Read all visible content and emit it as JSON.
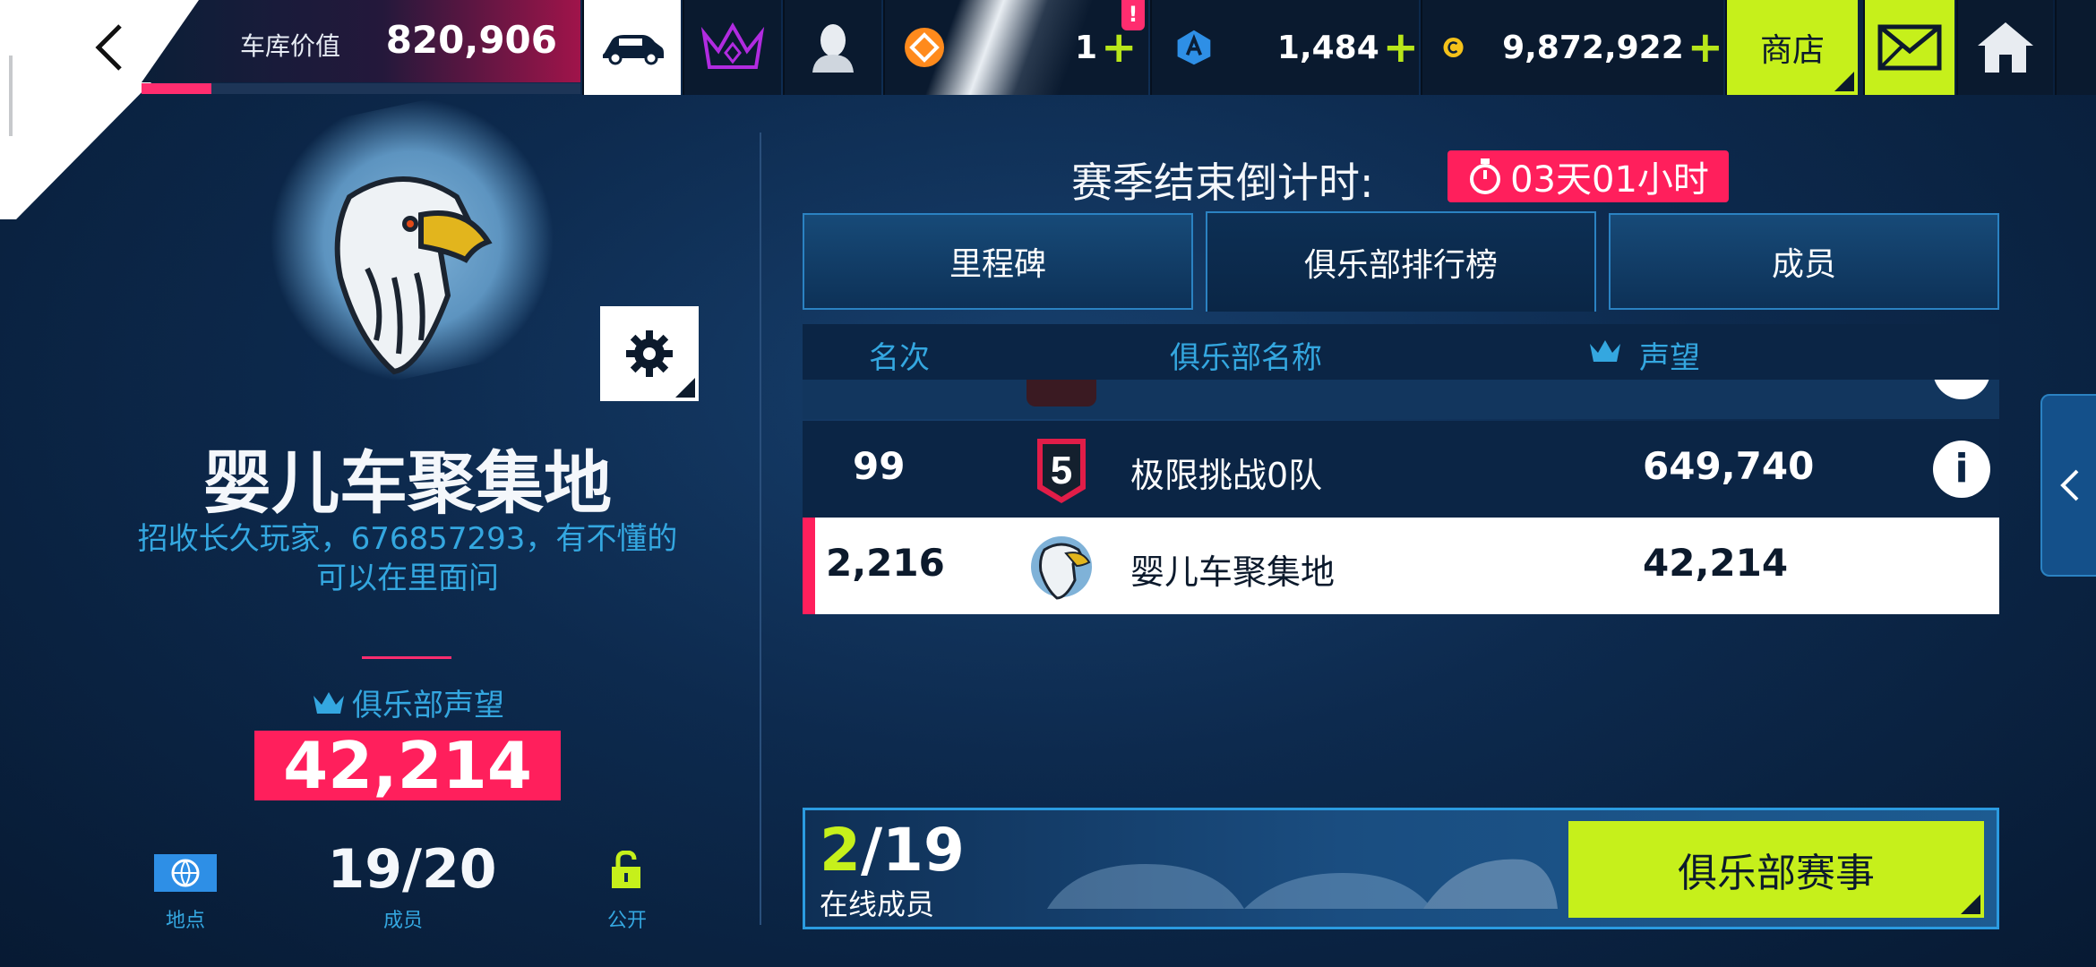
{
  "topbar": {
    "garage_label": "车库价值",
    "garage_value": "820,906",
    "garage_progress": 0.16,
    "icons": [
      "car-icon",
      "crown-icon",
      "profile-icon"
    ],
    "tokens_value": "1",
    "tokens_alert": "!",
    "blueprint_value": "1,484",
    "credits_value": "9,872,922",
    "plus_symbol": "+",
    "shop_label": "商店"
  },
  "countdown": {
    "label": "赛季结束倒计时:",
    "value": "03天01小时"
  },
  "tabs": [
    {
      "label": "里程碑"
    },
    {
      "label": "俱乐部排行榜"
    },
    {
      "label": "成员"
    }
  ],
  "table": {
    "col_rank": "名次",
    "col_name": "俱乐部名称",
    "col_prestige": "声望",
    "rows": [
      {
        "rank": "99",
        "logo_text": "5",
        "name": "极限挑战0队",
        "score": "649,740",
        "info": "i"
      },
      {
        "rank": "2,216",
        "name": "婴儿车聚集地",
        "score": "42,214"
      }
    ]
  },
  "club": {
    "name": "婴儿车聚集地",
    "description": "招收长久玩家，676857293，有不懂的可以在里面问",
    "prestige_label": "俱乐部声望",
    "prestige_value": "42,214",
    "location_label": "地点",
    "members_value": "19/20",
    "members_label": "成员",
    "privacy_label": "公开"
  },
  "bottom": {
    "online_now": "2",
    "online_total": "/19",
    "online_label": "在线成员",
    "events_button": "俱乐部赛事"
  },
  "colors": {
    "accent_pink": "#ff1f5c",
    "accent_lime": "#c6f01b",
    "accent_blue": "#34a7e0"
  }
}
